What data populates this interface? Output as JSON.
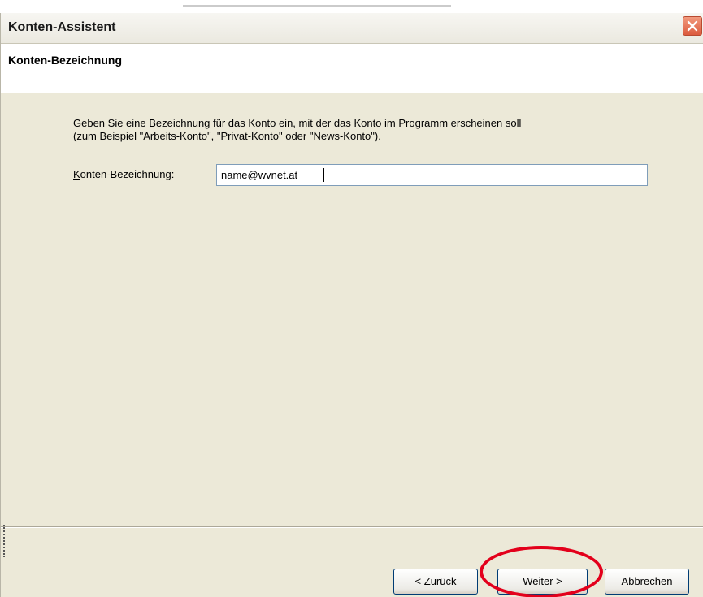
{
  "window": {
    "title": "Konten-Assistent"
  },
  "header": {
    "title": "Konten-Bezeichnung"
  },
  "content": {
    "description_line1": "Geben Sie eine Bezeichnung für das Konto ein, mit der das Konto im Programm erscheinen soll",
    "description_line2": "(zum Beispiel \"Arbeits-Konto\", \"Privat-Konto\" oder \"News-Konto\").",
    "field_label_mnemonic": "K",
    "field_label_rest": "onten-Bezeichnung:",
    "field_value": "name@wvnet.at"
  },
  "buttons": {
    "back_prefix": "< ",
    "back_mnemonic": "Z",
    "back_rest": "urück",
    "next_mnemonic": "W",
    "next_rest": "eiter >",
    "cancel": "Abbrechen"
  },
  "icons": {
    "close": "close-icon"
  },
  "colors": {
    "dialog_background": "#ece9d8",
    "close_button": "#dc5b3e",
    "highlight_ring": "#e3001b",
    "input_border": "#7f9db9"
  }
}
